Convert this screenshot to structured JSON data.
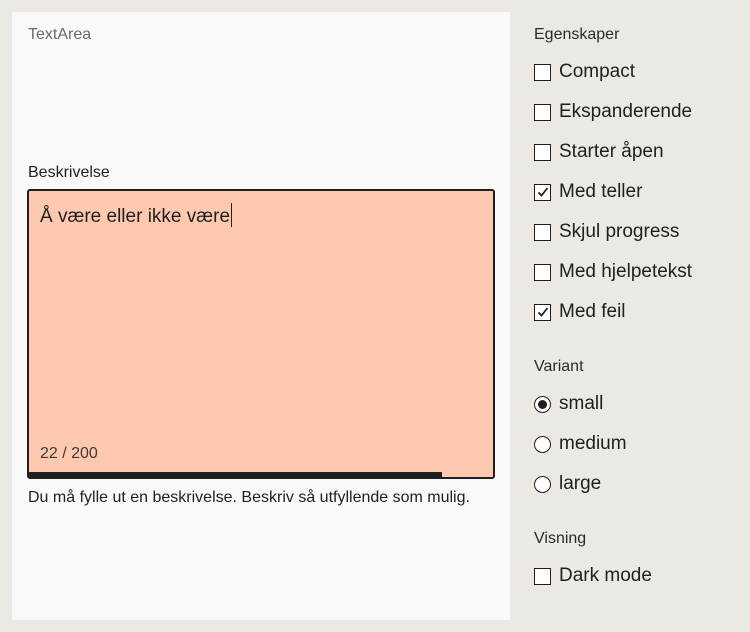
{
  "preview": {
    "title": "TextArea",
    "field_label": "Beskrivelse",
    "value": "Å være eller ikke være",
    "counter": "22 / 200",
    "progress_fraction": 0.89,
    "error_message": "Du må fylle ut en beskrivelse. Beskriv så utfyllende som mulig."
  },
  "panel": {
    "properties_heading": "Egenskaper",
    "properties": [
      {
        "label": "Compact",
        "checked": false
      },
      {
        "label": "Ekspanderende",
        "checked": false
      },
      {
        "label": "Starter åpen",
        "checked": false
      },
      {
        "label": "Med teller",
        "checked": true
      },
      {
        "label": "Skjul progress",
        "checked": false
      },
      {
        "label": "Med hjelpetekst",
        "checked": false
      },
      {
        "label": "Med feil",
        "checked": true
      }
    ],
    "variant_heading": "Variant",
    "variants": [
      {
        "label": "small",
        "checked": true
      },
      {
        "label": "medium",
        "checked": false
      },
      {
        "label": "large",
        "checked": false
      }
    ],
    "view_heading": "Visning",
    "view_options": [
      {
        "label": "Dark mode",
        "checked": false
      }
    ]
  }
}
